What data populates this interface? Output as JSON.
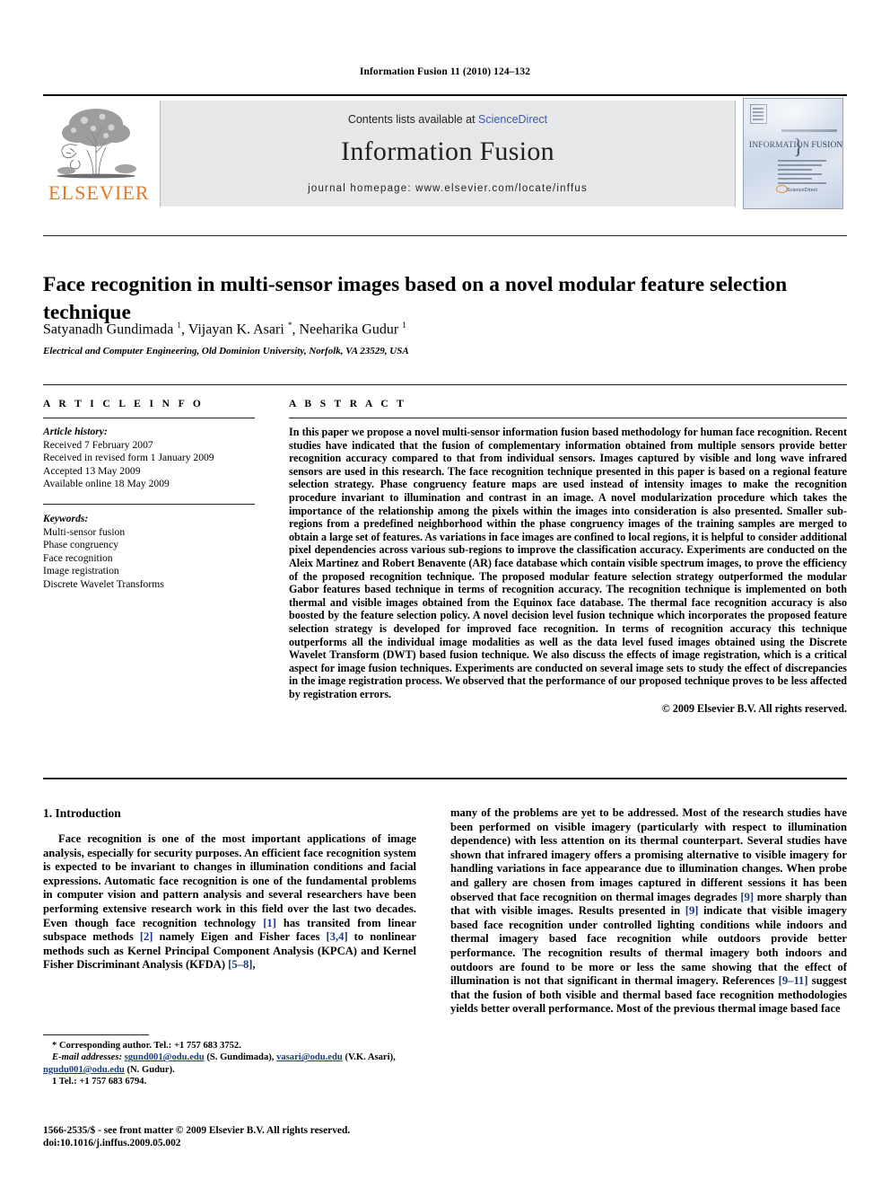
{
  "running_head": "Information Fusion 11 (2010) 124–132",
  "masthead": {
    "contents_prefix": "Contents lists available at ",
    "sciencedirect": "ScienceDirect",
    "journal_name": "Information Fusion",
    "homepage": "journal homepage: www.elsevier.com/locate/inffus",
    "publisher_wordmark": "ELSEVIER",
    "cover": {
      "title": "INFORMATION FUSION",
      "brace": "}",
      "sciencedirect_badge": "ScienceDirect"
    }
  },
  "article": {
    "title": "Face recognition in multi-sensor images based on a novel modular feature selection technique",
    "authors_html": "Satyanadh Gundimada <sup>1</sup>, Vijayan K. Asari <sup>*</sup>, Neeharika Gudur <sup>1</sup>",
    "affiliation": "Electrical and Computer Engineering, Old Dominion University, Norfolk, VA 23529, USA"
  },
  "article_info": {
    "heading": "A R T I C L E    I N F O",
    "history_label": "Article history:",
    "history": [
      "Received 7 February 2007",
      "Received in revised form 1 January 2009",
      "Accepted 13 May 2009",
      "Available online 18 May 2009"
    ],
    "keywords_label": "Keywords:",
    "keywords": [
      "Multi-sensor fusion",
      "Phase congruency",
      "Face recognition",
      "Image registration",
      "Discrete Wavelet Transforms"
    ]
  },
  "abstract": {
    "heading": "A B S T R A C T",
    "text": "In this paper we propose a novel multi-sensor information fusion based methodology for human face recognition. Recent studies have indicated that the fusion of complementary information obtained from multiple sensors provide better recognition accuracy compared to that from individual sensors. Images captured by visible and long wave infrared sensors are used in this research. The face recognition technique presented in this paper is based on a regional feature selection strategy. Phase congruency feature maps are used instead of intensity images to make the recognition procedure invariant to illumination and contrast in an image. A novel modularization procedure which takes the importance of the relationship among the pixels within the images into consideration is also presented. Smaller sub-regions from a predefined neighborhood within the phase congruency images of the training samples are merged to obtain a large set of features. As variations in face images are confined to local regions, it is helpful to consider additional pixel dependencies across various sub-regions to improve the classification accuracy. Experiments are conducted on the Aleix Martinez and Robert Benavente (AR) face database which contain visible spectrum images, to prove the efficiency of the proposed recognition technique. The proposed modular feature selection strategy outperformed the modular Gabor features based technique in terms of recognition accuracy. The recognition technique is implemented on both thermal and visible images obtained from the Equinox face database. The thermal face recognition accuracy is also boosted by the feature selection policy. A novel decision level fusion technique which incorporates the proposed feature selection strategy is developed for improved face recognition. In terms of recognition accuracy this technique outperforms all the individual image modalities as well as the data level fused images obtained using the Discrete Wavelet Transform (DWT) based fusion technique. We also discuss the effects of image registration, which is a critical aspect for image fusion techniques. Experiments are conducted on several image sets to study the effect of discrepancies in the image registration process. We observed that the performance of our proposed technique proves to be less affected by registration errors.",
    "copyright": "© 2009 Elsevier B.V. All rights reserved."
  },
  "introduction": {
    "heading": "1. Introduction",
    "left_para_1": "Face recognition is one of the most important applications of image analysis, especially for security purposes. An efficient face recognition system is expected to be invariant to changes in illumination conditions and facial expressions. Automatic face recognition is one of the fundamental problems in computer vision and pattern analysis and several researchers have been performing extensive research work in this field over the last two decades. Even though face recognition technology ",
    "left_ref_1": "[1]",
    "left_frag_2": " has transited from linear subspace methods ",
    "left_ref_2": "[2]",
    "left_frag_3": " namely Eigen and Fisher faces ",
    "left_ref_3": "[3,4]",
    "left_frag_4": " to nonlinear methods such as Kernel Principal Component Analysis (KPCA) and Kernel Fisher Discriminant Analysis (KFDA) ",
    "left_ref_4": "[5–8]",
    "left_frag_5": ",",
    "right_frag_1": "many of the problems are yet to be addressed. Most of the research studies have been performed on visible imagery (particularly with respect to illumination dependence) with less attention on its thermal counterpart. Several studies have shown that infrared imagery offers a promising alternative to visible imagery for handling variations in face appearance due to illumination changes. When probe and gallery are chosen from images captured in different sessions it has been observed that face recognition on thermal images degrades ",
    "right_ref_1": "[9]",
    "right_frag_2": " more sharply than that with visible images. Results presented in ",
    "right_ref_2": "[9]",
    "right_frag_3": " indicate that visible imagery based face recognition under controlled lighting conditions while indoors and thermal imagery based face recognition while outdoors provide better performance. The recognition results of thermal imagery both indoors and outdoors are found to be more or less the same showing that the effect of illumination is not that significant in thermal imagery. References ",
    "right_ref_3": "[9–11]",
    "right_frag_4": " suggest that the fusion of both visible and thermal based face recognition methodologies yields better overall performance. Most of the previous thermal image based face"
  },
  "footnotes": {
    "corresponding": "* Corresponding author. Tel.: +1 757 683 3752.",
    "email_label": "E-mail addresses:",
    "email_1": "sgund001@odu.edu",
    "email_1_name": " (S. Gundimada), ",
    "email_2": "vasari@odu.edu",
    "email_2_name": " (V.K. Asari), ",
    "email_3": "ngudu001@odu.edu",
    "email_3_name": " (N. Gudur).",
    "tel_note": "1 Tel.: +1 757 683 6794."
  },
  "imprint": {
    "line1": "1566-2535/$ - see front matter © 2009 Elsevier B.V. All rights reserved.",
    "line2": "doi:10.1016/j.inffus.2009.05.002"
  },
  "colors": {
    "link_blue": "#1a3a86",
    "sciencedirect_blue": "#3b5ba9",
    "elsevier_orange": "#E87722",
    "band_gray": "#e6e7e8"
  }
}
